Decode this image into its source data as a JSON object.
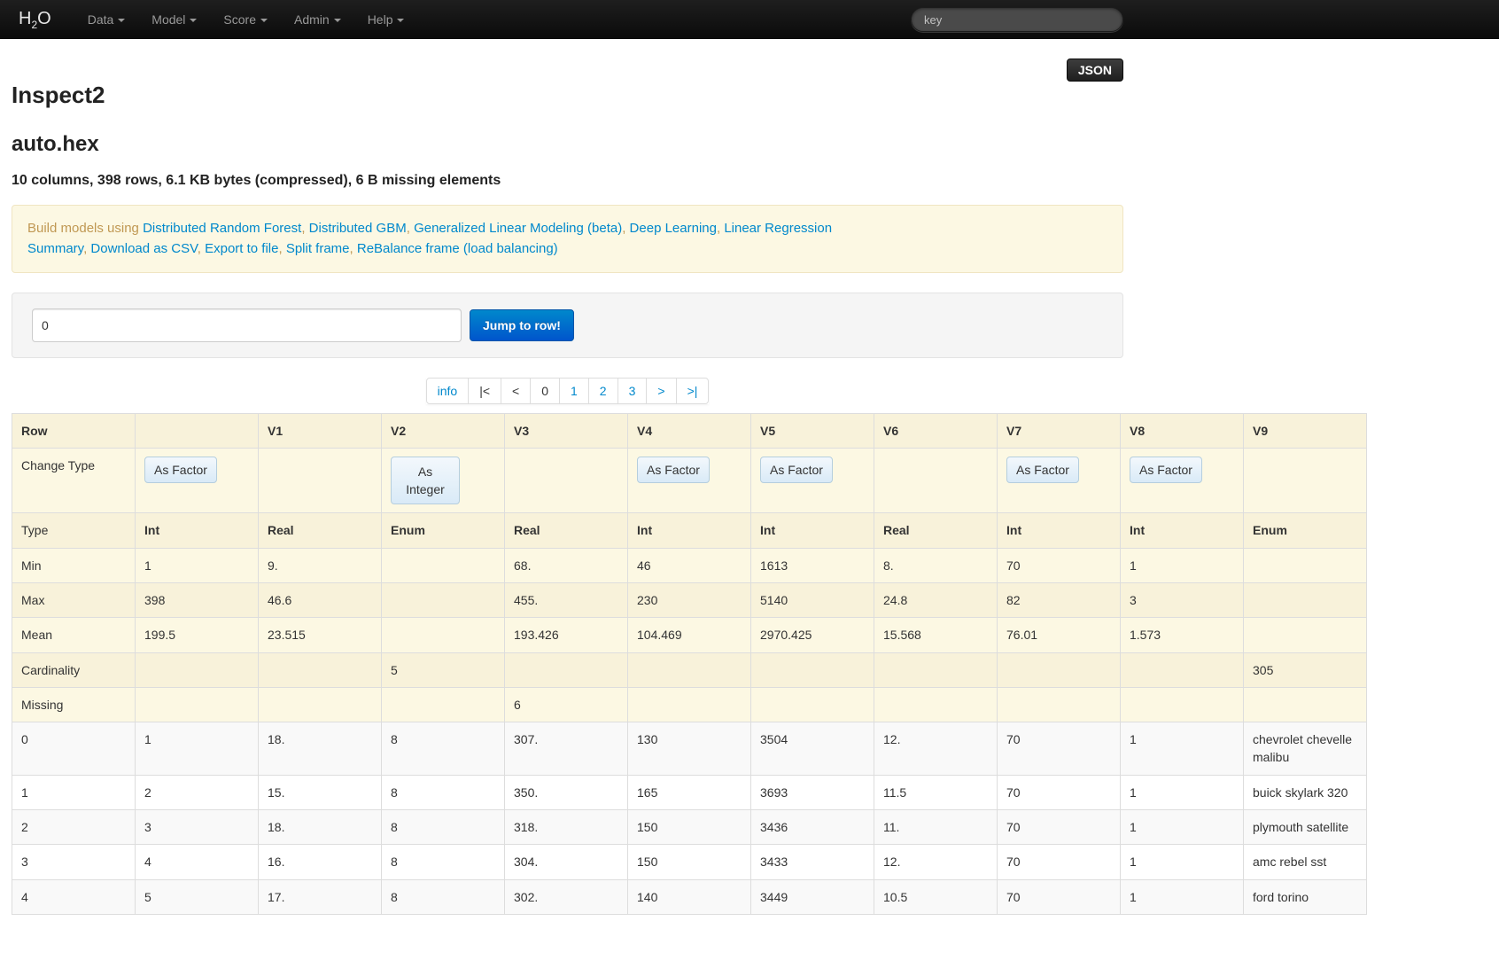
{
  "colors": {
    "navbar_bg": "#111111",
    "link_blue": "#0088cc",
    "alert_bg": "#fcf8e3",
    "alert_text": "#c09853",
    "primary_btn_top": "#0088cc",
    "primary_btn_bottom": "#0055cc",
    "table_cream": "#fcf8e3",
    "table_cream_alt": "#f8f2da",
    "change_type_btn_bg": "#d9eaf7"
  },
  "navbar": {
    "brand_h": "H",
    "brand_sub": "2",
    "brand_o": "O",
    "items": [
      {
        "label": "Data"
      },
      {
        "label": "Model"
      },
      {
        "label": "Score"
      },
      {
        "label": "Admin"
      },
      {
        "label": "Help"
      }
    ],
    "search_placeholder": "key"
  },
  "json_button_label": "JSON",
  "page": {
    "title": "Inspect2",
    "frame_name": "auto.hex",
    "summary": "10 columns, 398 rows, 6.1 KB bytes (compressed), 6 B missing elements"
  },
  "alert": {
    "prefix": "Build models using",
    "separator": ", ",
    "model_links": [
      "Distributed Random Forest",
      "Distributed GBM",
      "Generalized Linear Modeling (beta)",
      "Deep Learning",
      "Linear Regression"
    ],
    "action_links": [
      "Summary",
      "Download as CSV",
      "Export to file",
      "Split frame",
      "ReBalance frame (load balancing)"
    ]
  },
  "jump": {
    "value": "0",
    "button_label": "Jump to row!"
  },
  "pagination": [
    {
      "label": "info",
      "name": "info",
      "state": "link"
    },
    {
      "label": "|<",
      "name": "first",
      "state": "disabled"
    },
    {
      "label": "<",
      "name": "prev",
      "state": "disabled"
    },
    {
      "label": "0",
      "name": "page-0",
      "state": "active"
    },
    {
      "label": "1",
      "name": "page-1",
      "state": "link"
    },
    {
      "label": "2",
      "name": "page-2",
      "state": "link"
    },
    {
      "label": "3",
      "name": "page-3",
      "state": "link"
    },
    {
      "label": ">",
      "name": "next",
      "state": "link"
    },
    {
      "label": ">|",
      "name": "last",
      "state": "link"
    }
  ],
  "table": {
    "headers": [
      "Row",
      "",
      "V1",
      "V2",
      "V3",
      "V4",
      "V5",
      "V6",
      "V7",
      "V8",
      "V9"
    ],
    "change_type_row": {
      "label": "Change Type",
      "buttons": [
        "As Factor",
        "",
        "As Integer",
        "",
        "As Factor",
        "As Factor",
        "",
        "As Factor",
        "As Factor",
        ""
      ]
    },
    "meta_rows": [
      {
        "label": "Type",
        "cells": [
          "Int",
          "Real",
          "Enum",
          "Real",
          "Int",
          "Int",
          "Real",
          "Int",
          "Int",
          "Enum"
        ]
      },
      {
        "label": "Min",
        "cells": [
          "1",
          "9.",
          "",
          "68.",
          "46",
          "1613",
          "8.",
          "70",
          "1",
          ""
        ]
      },
      {
        "label": "Max",
        "cells": [
          "398",
          "46.6",
          "",
          "455.",
          "230",
          "5140",
          "24.8",
          "82",
          "3",
          ""
        ]
      },
      {
        "label": "Mean",
        "cells": [
          "199.5",
          "23.515",
          "",
          "193.426",
          "104.469",
          "2970.425",
          "15.568",
          "76.01",
          "1.573",
          ""
        ]
      },
      {
        "label": "Cardinality",
        "cells": [
          "",
          "",
          "5",
          "",
          "",
          "",
          "",
          "",
          "",
          "305"
        ]
      },
      {
        "label": "Missing",
        "cells": [
          "",
          "",
          "",
          "6",
          "",
          "",
          "",
          "",
          "",
          ""
        ]
      }
    ],
    "data_rows": [
      {
        "label": "0",
        "cells": [
          "1",
          "18.",
          "8",
          "307.",
          "130",
          "3504",
          "12.",
          "70",
          "1",
          "chevrolet chevelle malibu"
        ]
      },
      {
        "label": "1",
        "cells": [
          "2",
          "15.",
          "8",
          "350.",
          "165",
          "3693",
          "11.5",
          "70",
          "1",
          "buick skylark 320"
        ]
      },
      {
        "label": "2",
        "cells": [
          "3",
          "18.",
          "8",
          "318.",
          "150",
          "3436",
          "11.",
          "70",
          "1",
          "plymouth satellite"
        ]
      },
      {
        "label": "3",
        "cells": [
          "4",
          "16.",
          "8",
          "304.",
          "150",
          "3433",
          "12.",
          "70",
          "1",
          "amc rebel sst"
        ]
      },
      {
        "label": "4",
        "cells": [
          "5",
          "17.",
          "8",
          "302.",
          "140",
          "3449",
          "10.5",
          "70",
          "1",
          "ford torino"
        ]
      }
    ]
  }
}
